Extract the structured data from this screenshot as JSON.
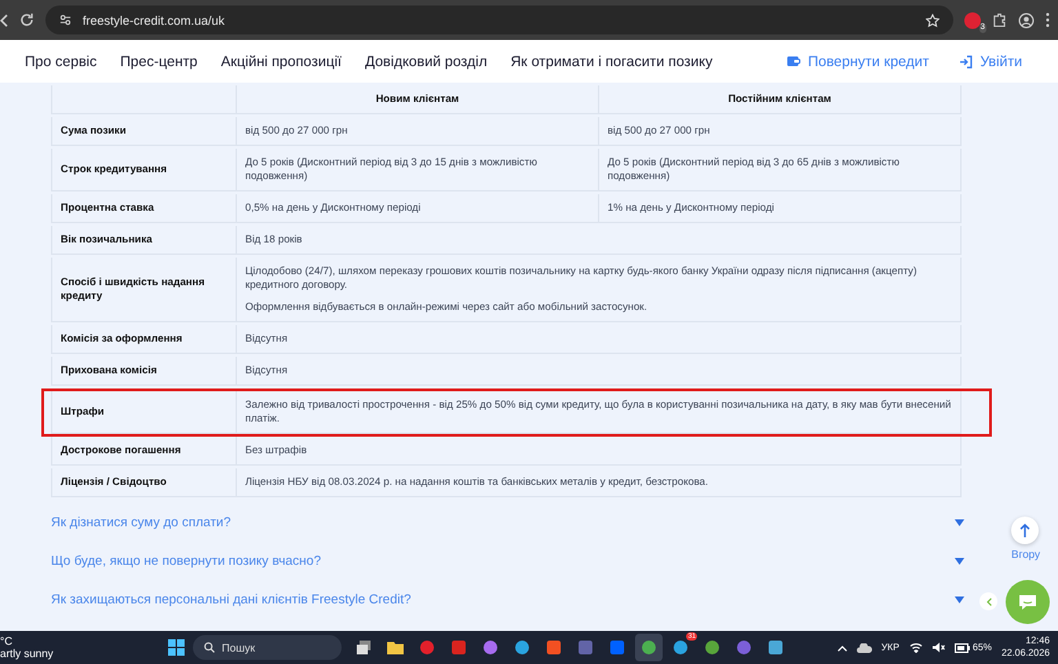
{
  "browser": {
    "url": "freestyle-credit.com.ua/uk",
    "extension_badge": "3"
  },
  "nav": {
    "items": [
      "Про сервіс",
      "Прес-центр",
      "Акційні пропозиції",
      "Довідковий розділ",
      "Як отримати і погасити позику"
    ],
    "actions": [
      {
        "kind": "wallet",
        "label": "Повернути кредит"
      },
      {
        "kind": "login",
        "label": "Увійти"
      }
    ]
  },
  "table": {
    "columns": [
      "Новим клієнтам",
      "Постійним клієнтам"
    ],
    "rows": [
      {
        "label": "Сума позики",
        "cells": [
          [
            "від 500 до 27 000 грн"
          ],
          [
            "від 500 до 27 000 грн"
          ]
        ],
        "highlighted": false
      },
      {
        "label": "Строк кредитування",
        "cells": [
          [
            "До 5 років (Дисконтний період від 3 до 15 днів з можливістю подовження)"
          ],
          [
            "До 5 років (Дисконтний період від 3 до 65 днів з можливістю подовження)"
          ]
        ],
        "highlighted": false
      },
      {
        "label": "Процентна ставка",
        "cells": [
          [
            "0,5% на день у Дисконтному періоді"
          ],
          [
            "1% на день у Дисконтному періоді"
          ]
        ],
        "highlighted": false
      },
      {
        "label": "Вік позичальника",
        "cells": [
          [
            "Від 18 років"
          ]
        ],
        "highlighted": false
      },
      {
        "label": "Спосіб і швидкість надання кредиту",
        "cells": [
          [
            "Цілодобово (24/7), шляхом переказу грошових коштів позичальнику на картку будь-якого банку України одразу після підписання (акцепту) кредитного договору.",
            "Оформлення відбувається в онлайн-режимі через сайт або мобільний застосунок."
          ]
        ],
        "highlighted": false
      },
      {
        "label": "Комісія за оформлення",
        "cells": [
          [
            "Відсутня"
          ]
        ],
        "highlighted": false
      },
      {
        "label": "Прихована комісія",
        "cells": [
          [
            "Відсутня"
          ]
        ],
        "highlighted": false
      },
      {
        "label": "Штрафи",
        "cells": [
          [
            "Залежно від тривалості прострочення - від 25% до 50% від суми кредиту, що була в користуванні позичальника на дату, в яку мав бути внесений платіж."
          ]
        ],
        "highlighted": true
      },
      {
        "label": "Дострокове погашення",
        "cells": [
          [
            "Без штрафів"
          ]
        ],
        "highlighted": false
      },
      {
        "label": "Ліцензія / Свідоцтво",
        "cells": [
          [
            "Ліцензія НБУ від 08.03.2024 р. на надання коштів та банківських металів у кредит, безстрокова."
          ]
        ],
        "highlighted": false
      }
    ]
  },
  "faq": [
    {
      "question": "Як дізнатися суму до сплати?",
      "expanded": false
    },
    {
      "question": "Що буде, якщо не повернути позику вчасно?",
      "expanded": false
    },
    {
      "question": "Як захищаються персональні дані клієнтів Freestyle Credit?",
      "expanded": false
    }
  ],
  "scroll_top": {
    "label": "Вгору"
  },
  "taskbar": {
    "weather_temp": "°C",
    "weather_text": "artly sunny",
    "search_placeholder": "Пошук",
    "apps": [
      {
        "kind": "taskview",
        "active": false
      },
      {
        "kind": "folder",
        "active": false
      },
      {
        "kind": "opera",
        "active": false
      },
      {
        "kind": "red",
        "active": false
      },
      {
        "kind": "copilot",
        "active": false
      },
      {
        "kind": "edge",
        "active": false
      },
      {
        "kind": "store",
        "active": false
      },
      {
        "kind": "teams",
        "active": false
      },
      {
        "kind": "dropbox",
        "active": false
      },
      {
        "kind": "chrome",
        "active": true
      },
      {
        "kind": "telegram",
        "active": false,
        "badge": "31"
      },
      {
        "kind": "torrent",
        "active": false
      },
      {
        "kind": "viber",
        "active": false
      },
      {
        "kind": "notepad",
        "active": false
      }
    ],
    "language": "УКР",
    "battery": "65%",
    "time": "12:46",
    "date": "22.06.2026"
  }
}
